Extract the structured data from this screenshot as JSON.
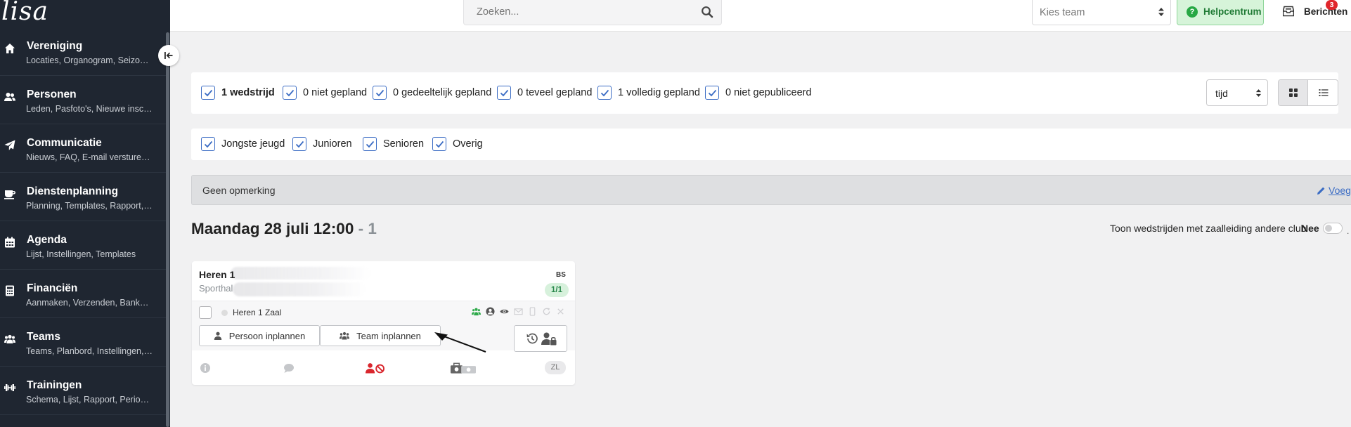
{
  "app": {
    "logo": "lisa"
  },
  "sidebar": {
    "items": [
      {
        "title": "Vereniging",
        "sub": "Locaties, Organogram, Seizoe…",
        "icon": "home-icon"
      },
      {
        "title": "Personen",
        "sub": "Leden, Pasfoto's, Nieuwe insc…",
        "icon": "users-icon"
      },
      {
        "title": "Communicatie",
        "sub": "Nieuws, FAQ, E-mail versturen…",
        "icon": "paper-plane-icon"
      },
      {
        "title": "Dienstenplanning",
        "sub": "Planning, Templates, Rapport,…",
        "icon": "coffee-icon"
      },
      {
        "title": "Agenda",
        "sub": "Lijst, Instellingen, Templates",
        "icon": "calendar-icon"
      },
      {
        "title": "Financiën",
        "sub": "Aanmaken, Verzenden, Bankb…",
        "icon": "calculator-icon"
      },
      {
        "title": "Teams",
        "sub": "Teams, Planbord, Instellingen,…",
        "icon": "teams-icon"
      },
      {
        "title": "Trainingen",
        "sub": "Schema, Lijst, Rapport, Period…",
        "icon": "dumbbell-icon"
      }
    ]
  },
  "topbar": {
    "search_placeholder": "Zoeken...",
    "team_placeholder": "Kies team",
    "help_label": "Helpcentrum",
    "messages_label": "Berichten",
    "messages_badge": "3"
  },
  "filters": {
    "status": [
      {
        "label": "1 wedstrijd",
        "checked": true,
        "bold": true
      },
      {
        "label": "0 niet gepland",
        "checked": true
      },
      {
        "label": "0 gedeeltelijk gepland",
        "checked": true
      },
      {
        "label": "0 teveel gepland",
        "checked": true
      },
      {
        "label": "1 volledig gepland",
        "checked": true
      },
      {
        "label": "0 niet gepubliceerd",
        "checked": true
      }
    ],
    "categories": [
      {
        "label": "Jongste jeugd",
        "checked": true
      },
      {
        "label": "Junioren",
        "checked": true
      },
      {
        "label": "Senioren",
        "checked": true
      },
      {
        "label": "Overig",
        "checked": true
      }
    ],
    "sort_value": "tijd",
    "view_mode": "grid"
  },
  "remark": {
    "text": "Geen opmerking",
    "add_label": "Voeg t"
  },
  "day": {
    "heading": "Maandag 28 juli 12:00",
    "count": "- 1",
    "toggle_label": "Toon wedstrijden met zaalleiding andere club",
    "toggle_value": "Nee",
    "trail": "."
  },
  "match": {
    "title": "Heren 1",
    "location": "Sporthal",
    "code": "BS",
    "count": "1/1",
    "slot_label": "Heren 1 Zaal",
    "btn_person": "Persoon inplannen",
    "btn_team": "Team inplannen",
    "zl": "ZL"
  },
  "colors": {
    "sidebar_bg": "#1f2631",
    "accent": "#3b6cc4",
    "help_green": "#27a844",
    "badge_red": "#e0262b",
    "danger": "#d9262d"
  }
}
